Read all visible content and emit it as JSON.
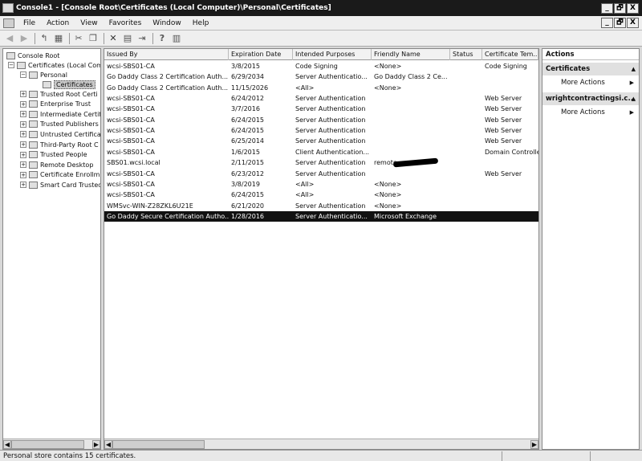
{
  "window": {
    "title": "Console1 - [Console Root\\Certificates (Local Computer)\\Personal\\Certificates]",
    "min_glyph": "_",
    "restore_glyph": "🗗",
    "close_glyph": "X"
  },
  "menu": {
    "items": [
      "File",
      "Action",
      "View",
      "Favorites",
      "Window",
      "Help"
    ]
  },
  "toolbar": {
    "icons": [
      "back-icon",
      "forward-icon",
      "up-icon",
      "show-hide-tree-icon",
      "cut-icon",
      "copy-icon",
      "delete-icon",
      "properties-icon",
      "export-list-icon",
      "help-icon",
      "show-hide-action-pane-icon"
    ]
  },
  "tree": {
    "root": "Console Root",
    "certs": "Certificates (Local Com",
    "personal": "Personal",
    "certificates": "Certificates",
    "stores": [
      "Trusted Root Certi",
      "Enterprise Trust",
      "Intermediate Certifi",
      "Trusted Publishers",
      "Untrusted Certifica",
      "Third-Party Root C",
      "Trusted People",
      "Remote Desktop",
      "Certificate Enrollme",
      "Smart Card Trusted"
    ]
  },
  "list": {
    "columns": [
      "Issued By",
      "Expiration Date",
      "Intended Purposes",
      "Friendly Name",
      "Status",
      "Certificate Tem..."
    ],
    "rows": [
      [
        "wcsi-SBS01-CA",
        "3/8/2015",
        "Code Signing",
        "<None>",
        "",
        "Code Signing"
      ],
      [
        "Go Daddy Class 2 Certification Auth...",
        "6/29/2034",
        "Server Authenticatio...",
        "Go Daddy Class 2 Ce...",
        "",
        ""
      ],
      [
        "Go Daddy Class 2 Certification Auth...",
        "11/15/2026",
        "<All>",
        "<None>",
        "",
        ""
      ],
      [
        "wcsi-SBS01-CA",
        "6/24/2012",
        "Server Authentication",
        "",
        "",
        "Web Server"
      ],
      [
        "wcsi-SBS01-CA",
        "3/7/2016",
        "Server Authentication",
        "",
        "",
        "Web Server"
      ],
      [
        "wcsi-SBS01-CA",
        "6/24/2015",
        "Server Authentication",
        "",
        "",
        "Web Server"
      ],
      [
        "wcsi-SBS01-CA",
        "6/24/2015",
        "Server Authentication",
        "",
        "",
        "Web Server"
      ],
      [
        "wcsi-SBS01-CA",
        "6/25/2014",
        "Server Authentication",
        "",
        "",
        "Web Server"
      ],
      [
        "wcsi-SBS01-CA",
        "1/6/2015",
        "Client Authentication...",
        "",
        "",
        "Domain Controller"
      ],
      [
        "SBS01.wcsi.local",
        "2/11/2015",
        "Server Authentication",
        "remote.",
        "",
        ""
      ],
      [
        "wcsi-SBS01-CA",
        "6/23/2012",
        "Server Authentication",
        "",
        "",
        "Web Server"
      ],
      [
        "wcsi-SBS01-CA",
        "3/8/2019",
        "<All>",
        "<None>",
        "",
        ""
      ],
      [
        "wcsi-SBS01-CA",
        "6/24/2015",
        "<All>",
        "<None>",
        "",
        ""
      ],
      [
        "WMSvc-WIN-Z28ZKL6U21E",
        "6/21/2020",
        "Server Authentication",
        "<None>",
        "",
        ""
      ],
      [
        "Go Daddy Secure Certification Autho...",
        "1/28/2016",
        "Server Authenticatio...",
        "Microsoft Exchange",
        "",
        ""
      ]
    ],
    "selected_row": 14
  },
  "actions": {
    "header": "Actions",
    "sections": [
      {
        "title": "Certificates",
        "items": [
          "More Actions"
        ]
      },
      {
        "title": "wrightcontractingsi.c...",
        "items": [
          "More Actions"
        ]
      }
    ]
  },
  "status": {
    "text": "Personal store contains 15 certificates."
  }
}
